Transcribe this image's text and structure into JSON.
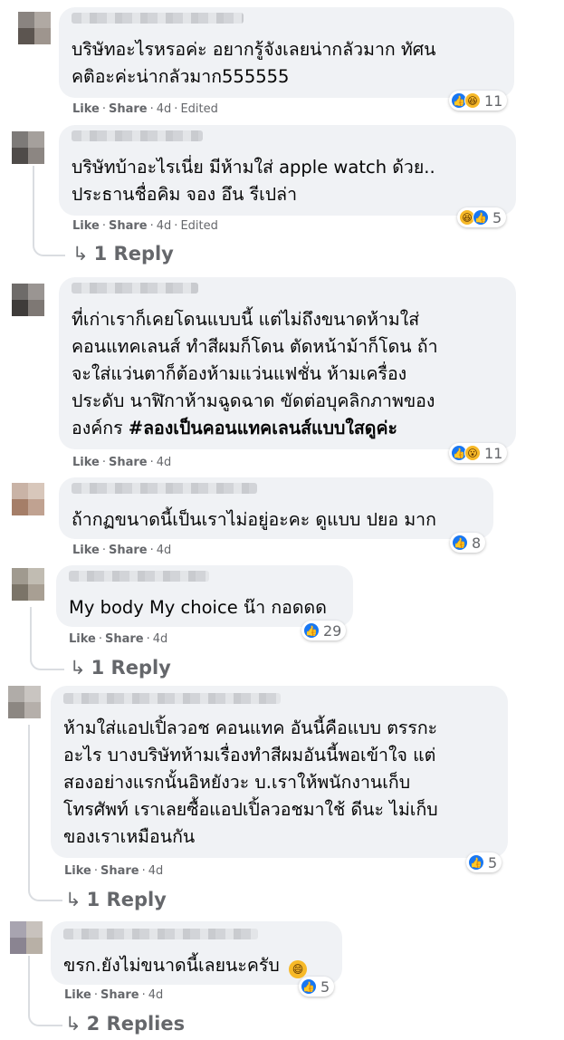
{
  "comments": [
    {
      "text_lines": [
        "บริษัทอะไรหรอค่ะ อยากรู้จังเลยน่ากลัวมาก ทัศน",
        "คติอะค่ะน่ากลัวมาก555555"
      ],
      "like_label": "Like",
      "share_label": "Share",
      "age": "4d",
      "edited": "Edited",
      "reaction_count": "11",
      "reaction_icons": [
        "like-icon",
        "haha-icon"
      ]
    },
    {
      "text_lines": [
        "บริษัทบ้าอะไรเนี่ย มีห้ามใส่ apple watch ด้วย..",
        "ประธานชื่อคิม จอง อึน รีเปล่า"
      ],
      "like_label": "Like",
      "share_label": "Share",
      "age": "4d",
      "edited": "Edited",
      "reaction_count": "5",
      "reaction_icons": [
        "haha-icon",
        "like-icon"
      ],
      "replies_label": "1 Reply"
    },
    {
      "text_lines": [
        "ที่เก่าเราก็เคยโดนแบบนี้ แต่ไม่ถึงขนาดห้ามใส่",
        "คอนแทคเลนส์ ทำสีผมก็โดน ตัดหน้าม้าก็โดน ถ้า",
        "จะใส่แว่นตาก็ต้องห้ามแว่นแฟชั่น ห้ามเครื่อง",
        "ประดับ นาฬิกาห้ามฉูดฉาด ขัดต่อบุคลิกภาพของ",
        "องค์กร "
      ],
      "hashtag": "#ลองเป็นคอนแทคเลนส์แบบใสดูค่ะ",
      "like_label": "Like",
      "share_label": "Share",
      "age": "4d",
      "reaction_count": "11",
      "reaction_icons": [
        "like-icon",
        "wow-icon"
      ]
    },
    {
      "text_lines": [
        "ถ้ากฏขนาดนี้เป็นเราไม่อยู่อะคะ ดูแบบ ปยอ มาก"
      ],
      "like_label": "Like",
      "share_label": "Share",
      "age": "4d",
      "reaction_count": "8",
      "reaction_icons": [
        "like-icon"
      ]
    },
    {
      "text_lines": [
        "My body My choice น๊า กอดดด"
      ],
      "like_label": "Like",
      "share_label": "Share",
      "age": "4d",
      "reaction_count": "29",
      "reaction_icons": [
        "like-icon"
      ],
      "replies_label": "1 Reply"
    },
    {
      "text_lines": [
        "ห้ามใส่แอปเปิ้ลวอช คอนแทค อันนี้คือแบบ ตรรกะ",
        "อะไร บางบริษัทห้ามเรื่องทำสีผมอันนี้พอเข้าใจ แต่",
        "สองอย่างแรกนั้นอิหยังวะ บ.เราให้พนักงานเก็บ",
        "โทรศัพท์ เราเลยซื้อแอปเปิ้ลวอชมาใช้ ดีนะ ไม่เก็บ",
        "ของเราเหมือนกัน"
      ],
      "like_label": "Like",
      "share_label": "Share",
      "age": "4d",
      "reaction_count": "5",
      "reaction_icons": [
        "like-icon"
      ],
      "replies_label": "1 Reply"
    },
    {
      "text_lines": [
        "ขรก.ยังไม่ขนาดนี้เลยนะครับ "
      ],
      "inline_emoji": "😄",
      "like_label": "Like",
      "share_label": "Share",
      "age": "4d",
      "reaction_count": "5",
      "reaction_icons": [
        "like-icon"
      ],
      "replies_label": "2 Replies"
    }
  ],
  "colors": {
    "bubble": "#f0f2f5",
    "meta_text": "#65676b",
    "like_blue": "#1877f2",
    "emoji_yellow": "#f7b928"
  }
}
